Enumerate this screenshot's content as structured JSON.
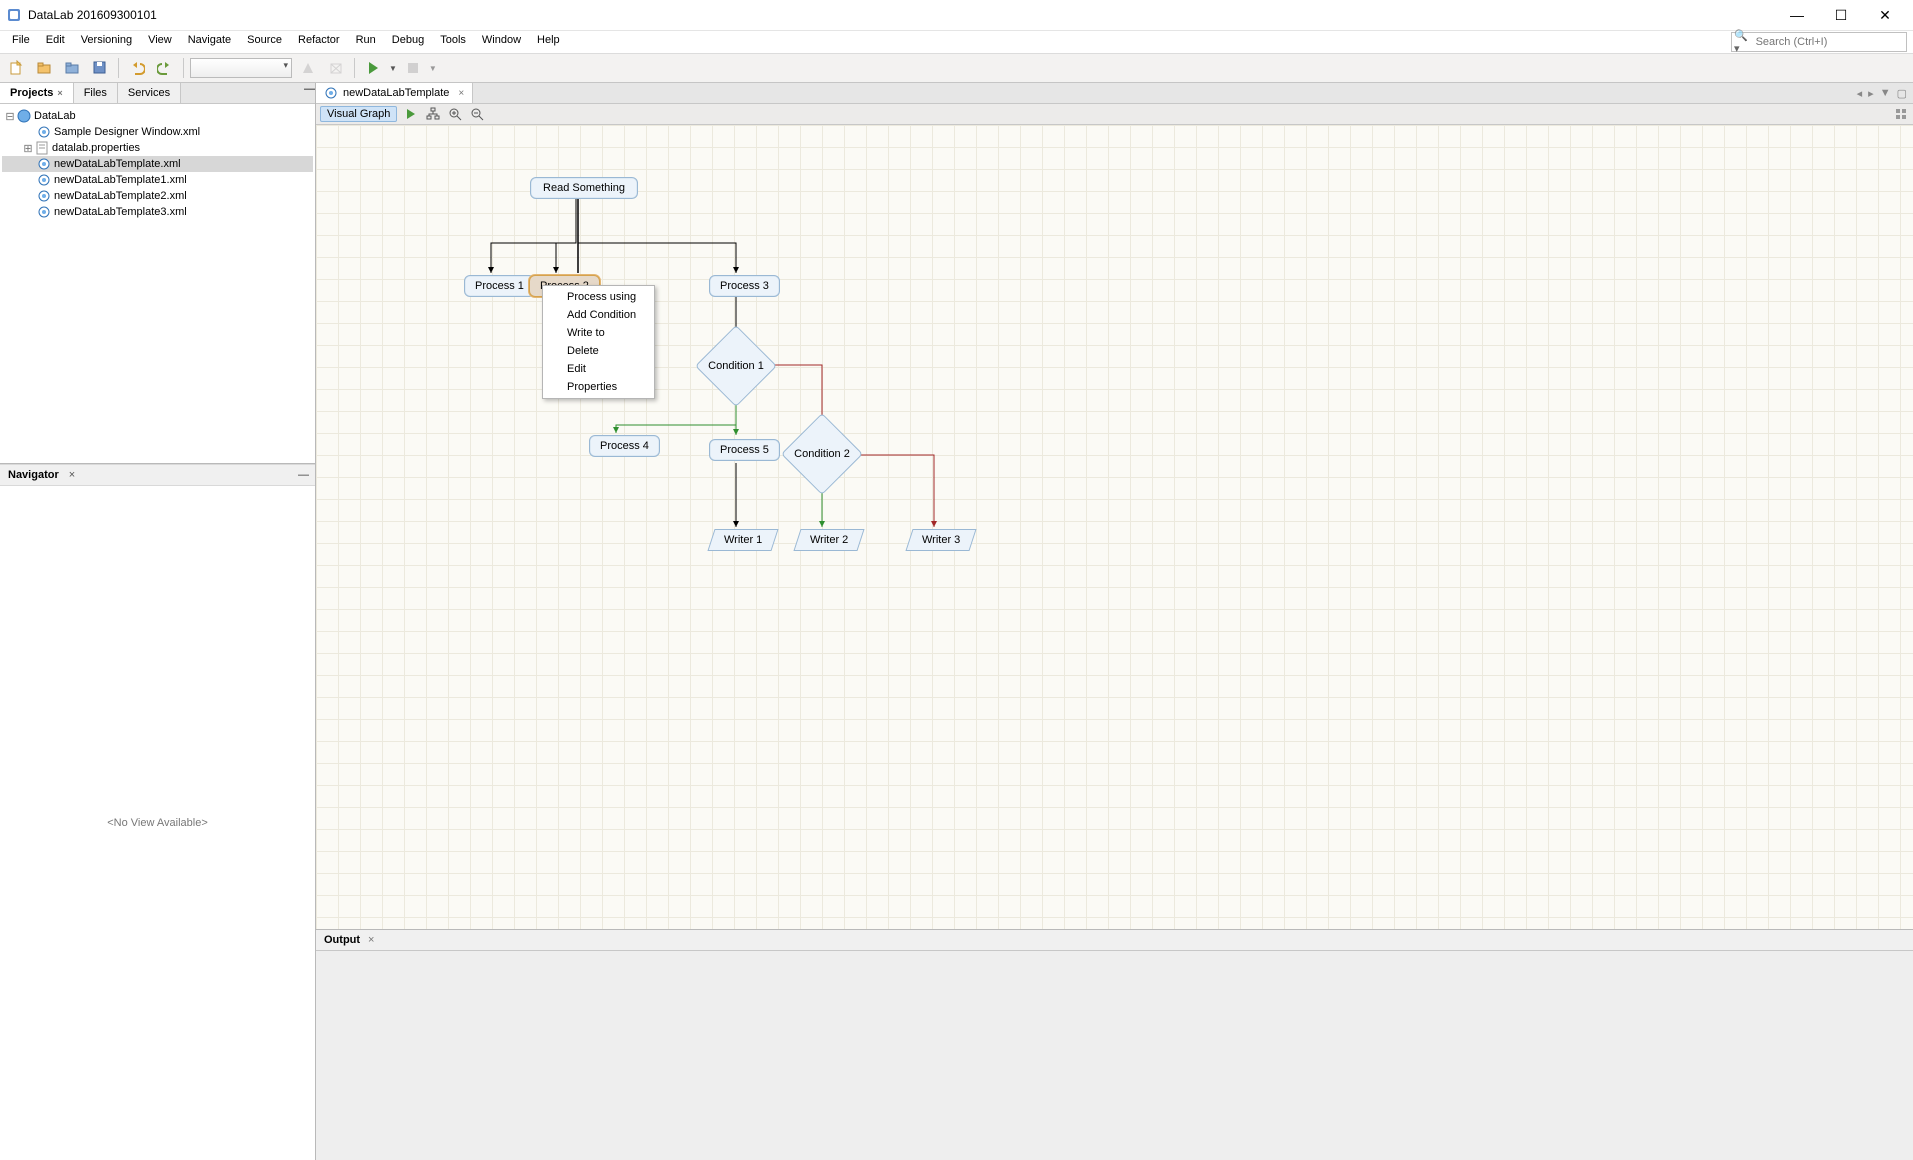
{
  "app": {
    "title": "DataLab 201609300101"
  },
  "menu": [
    "File",
    "Edit",
    "Versioning",
    "View",
    "Navigate",
    "Source",
    "Refactor",
    "Run",
    "Debug",
    "Tools",
    "Window",
    "Help"
  ],
  "search": {
    "placeholder": "Search (Ctrl+I)"
  },
  "left": {
    "tabs": [
      {
        "label": "Projects",
        "active": true,
        "closable": true
      },
      {
        "label": "Files",
        "active": false,
        "closable": false
      },
      {
        "label": "Services",
        "active": false,
        "closable": false
      }
    ],
    "tree": {
      "root": "DataLab",
      "items": [
        {
          "label": "Sample Designer Window.xml",
          "indent": 2,
          "icon": "xml",
          "sel": false
        },
        {
          "label": "datalab.properties",
          "indent": 2,
          "icon": "prop",
          "expander": "+",
          "sel": false
        },
        {
          "label": "newDataLabTemplate.xml",
          "indent": 2,
          "icon": "xml",
          "sel": true
        },
        {
          "label": "newDataLabTemplate1.xml",
          "indent": 2,
          "icon": "xml",
          "sel": false
        },
        {
          "label": "newDataLabTemplate2.xml",
          "indent": 2,
          "icon": "xml",
          "sel": false
        },
        {
          "label": "newDataLabTemplate3.xml",
          "indent": 2,
          "icon": "xml",
          "sel": false
        }
      ]
    },
    "navigator": {
      "title": "Navigator",
      "empty": "<No View Available>"
    }
  },
  "editor": {
    "tab": {
      "label": "newDataLabTemplate"
    },
    "mode": "Visual Graph"
  },
  "graph": {
    "nodes": {
      "read": "Read Something",
      "p1": "Process 1",
      "p2": "Process 2",
      "p3": "Process 3",
      "p4": "Process 4",
      "p5": "Process 5",
      "c1": "Condition 1",
      "c2": "Condition 2",
      "w1": "Writer 1",
      "w2": "Writer 2",
      "w3": "Writer 3"
    },
    "context_menu": [
      "Process using",
      "Add Condition",
      "Write to",
      "Delete",
      "Edit",
      "Properties"
    ]
  },
  "output": {
    "title": "Output"
  }
}
